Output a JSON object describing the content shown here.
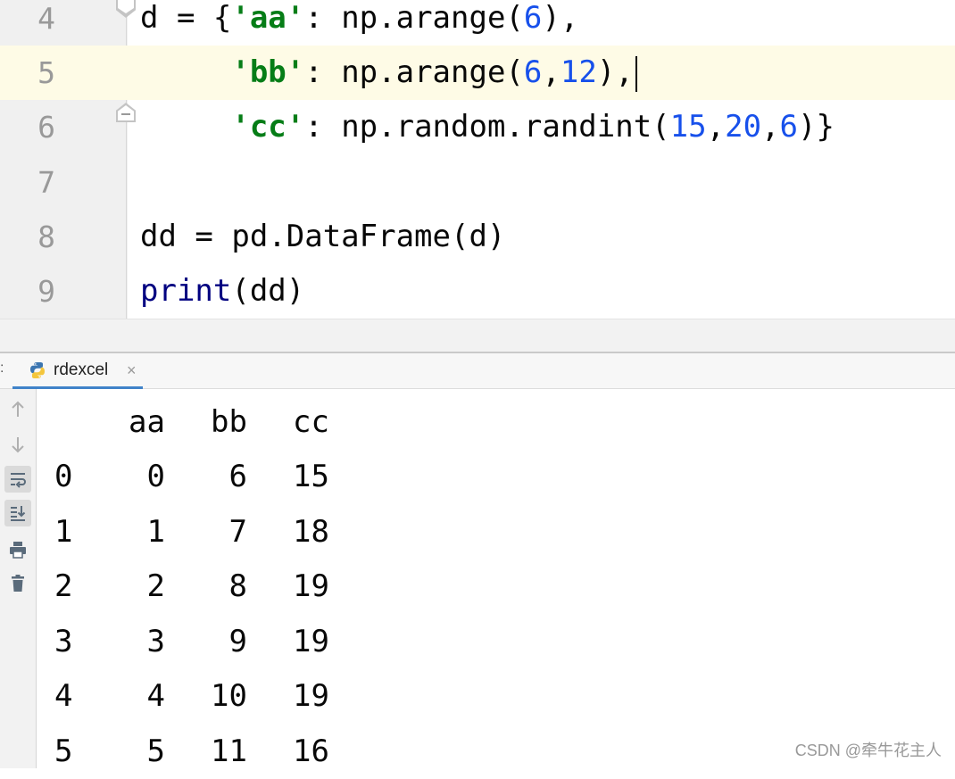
{
  "editor": {
    "lines": [
      {
        "number": "4",
        "tokens": [
          {
            "t": "d = {",
            "c": "plain"
          },
          {
            "t": "'aa'",
            "c": "str"
          },
          {
            "t": ": np.arange(",
            "c": "plain"
          },
          {
            "t": "6",
            "c": "num"
          },
          {
            "t": "),",
            "c": "plain"
          }
        ]
      },
      {
        "number": "5",
        "tokens": [
          {
            "t": "     ",
            "c": "plain"
          },
          {
            "t": "'bb'",
            "c": "str"
          },
          {
            "t": ": np.arange(",
            "c": "plain"
          },
          {
            "t": "6",
            "c": "num"
          },
          {
            "t": ",",
            "c": "plain"
          },
          {
            "t": "12",
            "c": "num"
          },
          {
            "t": "),",
            "c": "plain"
          }
        ]
      },
      {
        "number": "6",
        "tokens": [
          {
            "t": "     ",
            "c": "plain"
          },
          {
            "t": "'cc'",
            "c": "str"
          },
          {
            "t": ": np.random.randint(",
            "c": "plain"
          },
          {
            "t": "15",
            "c": "num"
          },
          {
            "t": ",",
            "c": "plain"
          },
          {
            "t": "20",
            "c": "num"
          },
          {
            "t": ",",
            "c": "plain"
          },
          {
            "t": "6",
            "c": "num"
          },
          {
            "t": ")}",
            "c": "plain"
          }
        ]
      },
      {
        "number": "7",
        "tokens": []
      },
      {
        "number": "8",
        "tokens": [
          {
            "t": "dd = pd.DataFrame(d)",
            "c": "plain"
          }
        ]
      },
      {
        "number": "9",
        "tokens": [
          {
            "t": "print",
            "c": "builtin"
          },
          {
            "t": "(dd)",
            "c": "plain"
          }
        ]
      }
    ],
    "current_line": "5"
  },
  "run_panel": {
    "tab_prefix": ":",
    "tab_label": "rdexcel",
    "tab_close": "×",
    "tools": [
      "up-arrow-icon",
      "down-arrow-icon",
      "soft-wrap-icon",
      "scroll-to-end-icon",
      "print-icon",
      "trash-icon"
    ]
  },
  "console": {
    "header": {
      "idx": "",
      "aa": "aa",
      "bb": "bb",
      "cc": "cc"
    },
    "rows": [
      {
        "idx": "0",
        "aa": "0",
        "bb": "6",
        "cc": "15"
      },
      {
        "idx": "1",
        "aa": "1",
        "bb": "7",
        "cc": "18"
      },
      {
        "idx": "2",
        "aa": "2",
        "bb": "8",
        "cc": "19"
      },
      {
        "idx": "3",
        "aa": "3",
        "bb": "9",
        "cc": "19"
      },
      {
        "idx": "4",
        "aa": "4",
        "bb": "10",
        "cc": "19"
      },
      {
        "idx": "5",
        "aa": "5",
        "bb": "11",
        "cc": "16"
      }
    ]
  },
  "watermark": "CSDN @牵牛花主人"
}
